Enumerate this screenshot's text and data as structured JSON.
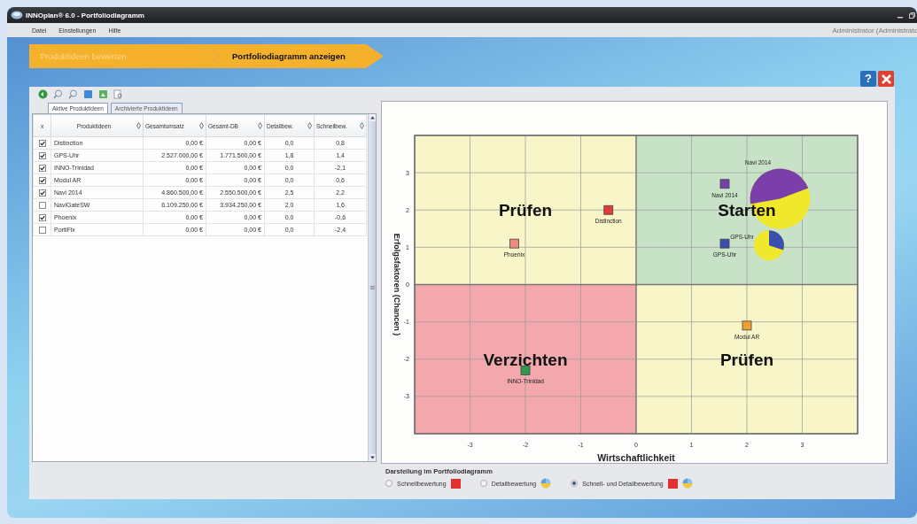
{
  "window": {
    "title": "INNOplan® 6.0 - Portfoliodiagramm",
    "user": "Administrator (Administrato"
  },
  "menu": [
    "Datei",
    "Einstellungen",
    "Hilfe"
  ],
  "steps": [
    {
      "label": "Produktideen bewerten",
      "selected": false
    },
    {
      "label": "Portfoliodiagramm anzeigen",
      "selected": true
    }
  ],
  "help_button": "?",
  "tabs": [
    {
      "label": "Aktive Produktideen",
      "selected": true
    },
    {
      "label": "Archivierte Produktideen",
      "selected": false
    }
  ],
  "table": {
    "columns": [
      "x",
      "Produktideen",
      "Gesamtumsatz",
      "Gesamt-DB",
      "Detailbew.",
      "Schnellbew."
    ],
    "rows": [
      {
        "checked": true,
        "cells": [
          "",
          "Distinction",
          "0,00 €",
          "0,00 €",
          "0,0",
          "0,8"
        ]
      },
      {
        "checked": true,
        "cells": [
          "",
          "GPS-Uhr",
          "2.527.000,00 €",
          "1.771.500,00 €",
          "1,8",
          "1,4"
        ]
      },
      {
        "checked": true,
        "cells": [
          "",
          "INNO-Trinidad",
          "0,00 €",
          "0,00 €",
          "0,0",
          "-2,1"
        ]
      },
      {
        "checked": true,
        "cells": [
          "",
          "Modul AR",
          "0,00 €",
          "0,00 €",
          "0,0",
          "0,6"
        ]
      },
      {
        "checked": true,
        "cells": [
          "",
          "Navi 2014",
          "4.860.500,00 €",
          "2.550.500,00 €",
          "2,5",
          "2,2"
        ]
      },
      {
        "checked": false,
        "cells": [
          "",
          "NaviGateSW",
          "6.109.250,00 €",
          "3.934.250,00 €",
          "2,0",
          "1,6"
        ]
      },
      {
        "checked": true,
        "cells": [
          "",
          "Phoenix",
          "0,00 €",
          "0,00 €",
          "0,0",
          "-0,6"
        ]
      },
      {
        "checked": false,
        "cells": [
          "",
          "PortiFix",
          "0,00 €",
          "0,00 €",
          "0,0",
          "-2,4"
        ]
      }
    ]
  },
  "chart": {
    "quadrants": [
      {
        "label": "Prüfen",
        "color": "#f8f5c8"
      },
      {
        "label": "Starten",
        "color": "#c8e2c8"
      },
      {
        "label": "Verzichten",
        "color": "#f2a8ac"
      },
      {
        "label": "Prüfen",
        "color": "#f8f5c8"
      }
    ],
    "chart_data": {
      "type": "scatter",
      "xlabel": "Wirtschaftlichkeit",
      "ylabel": "Erfolgsfaktoren (Chancen )",
      "xlim": [
        -4,
        4
      ],
      "ylim": [
        -4,
        4
      ],
      "xticks": [
        -3,
        -2,
        -1,
        0,
        1,
        2,
        3
      ],
      "grid": true,
      "yticks": [
        -3,
        -2,
        -1,
        0,
        1,
        2,
        3
      ],
      "x": [
        -0.5,
        -2.2,
        1.6,
        1.6,
        2.0,
        -2.0
      ],
      "series": [
        {
          "name": "Distinction",
          "color": "#e03a3a",
          "values": [
            2.0,
            null,
            null,
            null,
            null,
            null
          ]
        },
        {
          "name": "Phoenix",
          "color": "#f08a80",
          "values": [
            null,
            1.1,
            null,
            null,
            null,
            null
          ]
        },
        {
          "name": "Navi 2014",
          "color": "#7a3fa8",
          "values": [
            null,
            null,
            2.7,
            null,
            null,
            null
          ]
        },
        {
          "name": "GPS-Uhr",
          "color": "#3a4fb0",
          "values": [
            null,
            null,
            null,
            1.1,
            null,
            null
          ]
        },
        {
          "name": "Modul AR",
          "color": "#f0a030",
          "values": [
            null,
            null,
            null,
            null,
            -1.1,
            null
          ]
        },
        {
          "name": "INNO-Trinidad",
          "color": "#2e9a4e",
          "values": [
            null,
            null,
            null,
            null,
            null,
            -2.3
          ]
        }
      ]
    },
    "bubbles": [
      {
        "label": "Navi 2014",
        "color": "#7a3fa8"
      },
      {
        "label": "GPS-Uhr",
        "color": "#3a4fb0"
      }
    ]
  },
  "legend": {
    "title": "Darstellung im Portfoliodiagramm",
    "options": [
      {
        "label": "Schnellbewertung",
        "selected": false,
        "kind": "square"
      },
      {
        "label": "Detailbewertung",
        "selected": false,
        "kind": "pie"
      },
      {
        "label": "Schnell- und Detailbewertung",
        "selected": true,
        "kind": "both"
      }
    ]
  }
}
